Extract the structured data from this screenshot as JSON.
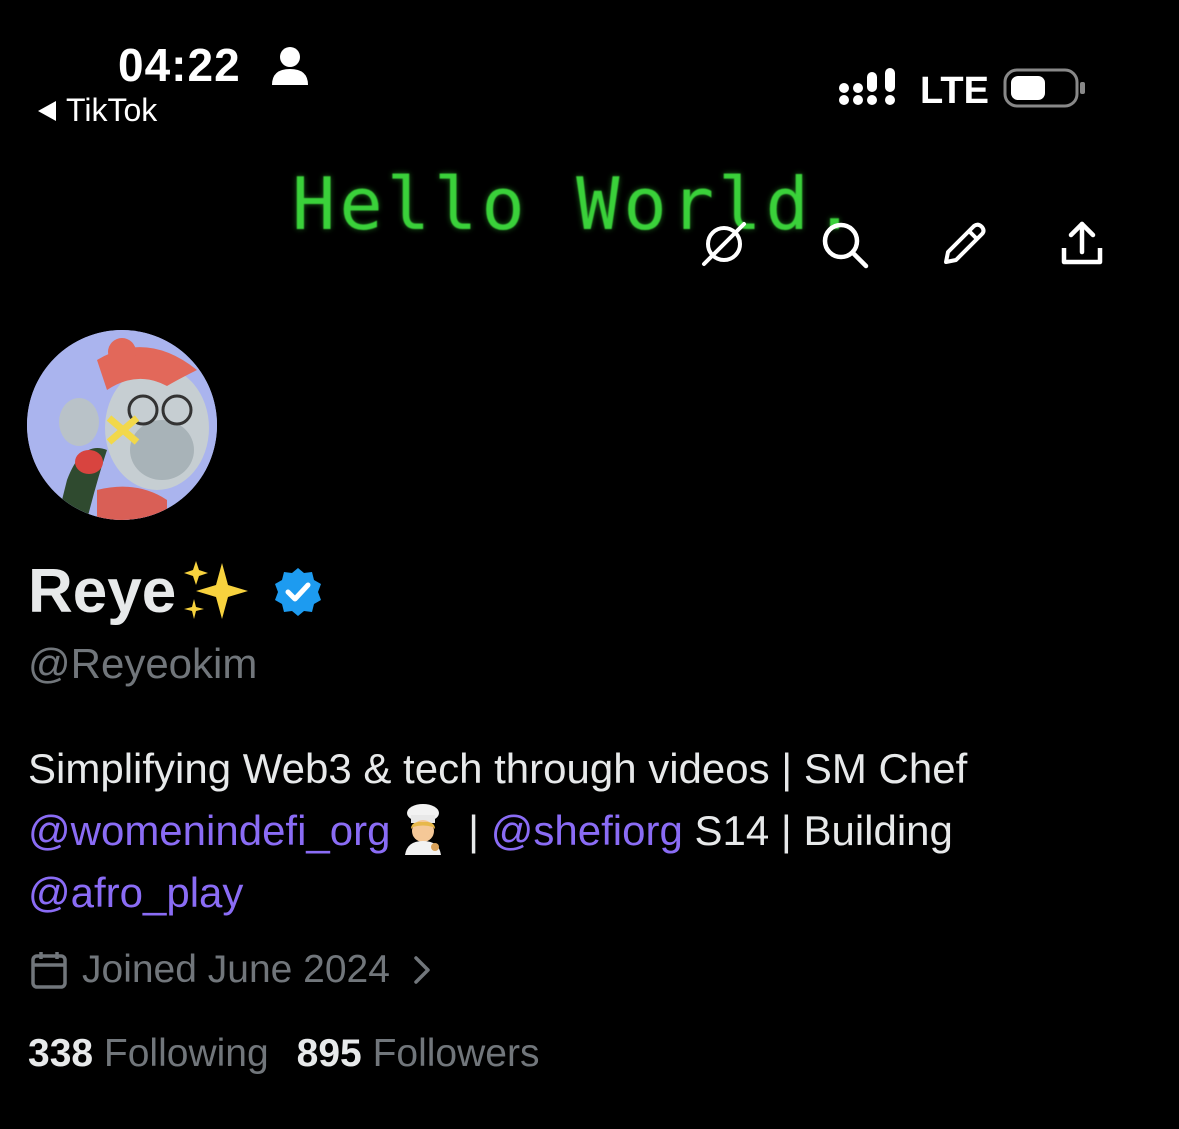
{
  "status_bar": {
    "time": "04:22",
    "back_app": "TikTok",
    "carrier": "LTE"
  },
  "banner": {
    "text": "Hello World."
  },
  "actions": [
    "grok-icon",
    "search-icon",
    "edit-icon",
    "share-icon"
  ],
  "profile": {
    "name": "Reye",
    "handle": "@Reyeokim",
    "bio": {
      "line1": "Simplifying Web3 & tech through videos | SM Chef",
      "mention1": "@womenindefi_org",
      "sep1": " | ",
      "mention2": "@shefiorg",
      "after2": " S14 | Building",
      "mention3": "@afro_play"
    },
    "joined": "Joined June 2024",
    "following_count": "338",
    "following_label": "Following",
    "followers_count": "895",
    "followers_label": "Followers"
  },
  "colors": {
    "background": "#000000",
    "mention": "#8a6cf5",
    "secondary_text": "#71767b",
    "verified": "#1d9bf0",
    "banner_text": "#3ad13a"
  }
}
